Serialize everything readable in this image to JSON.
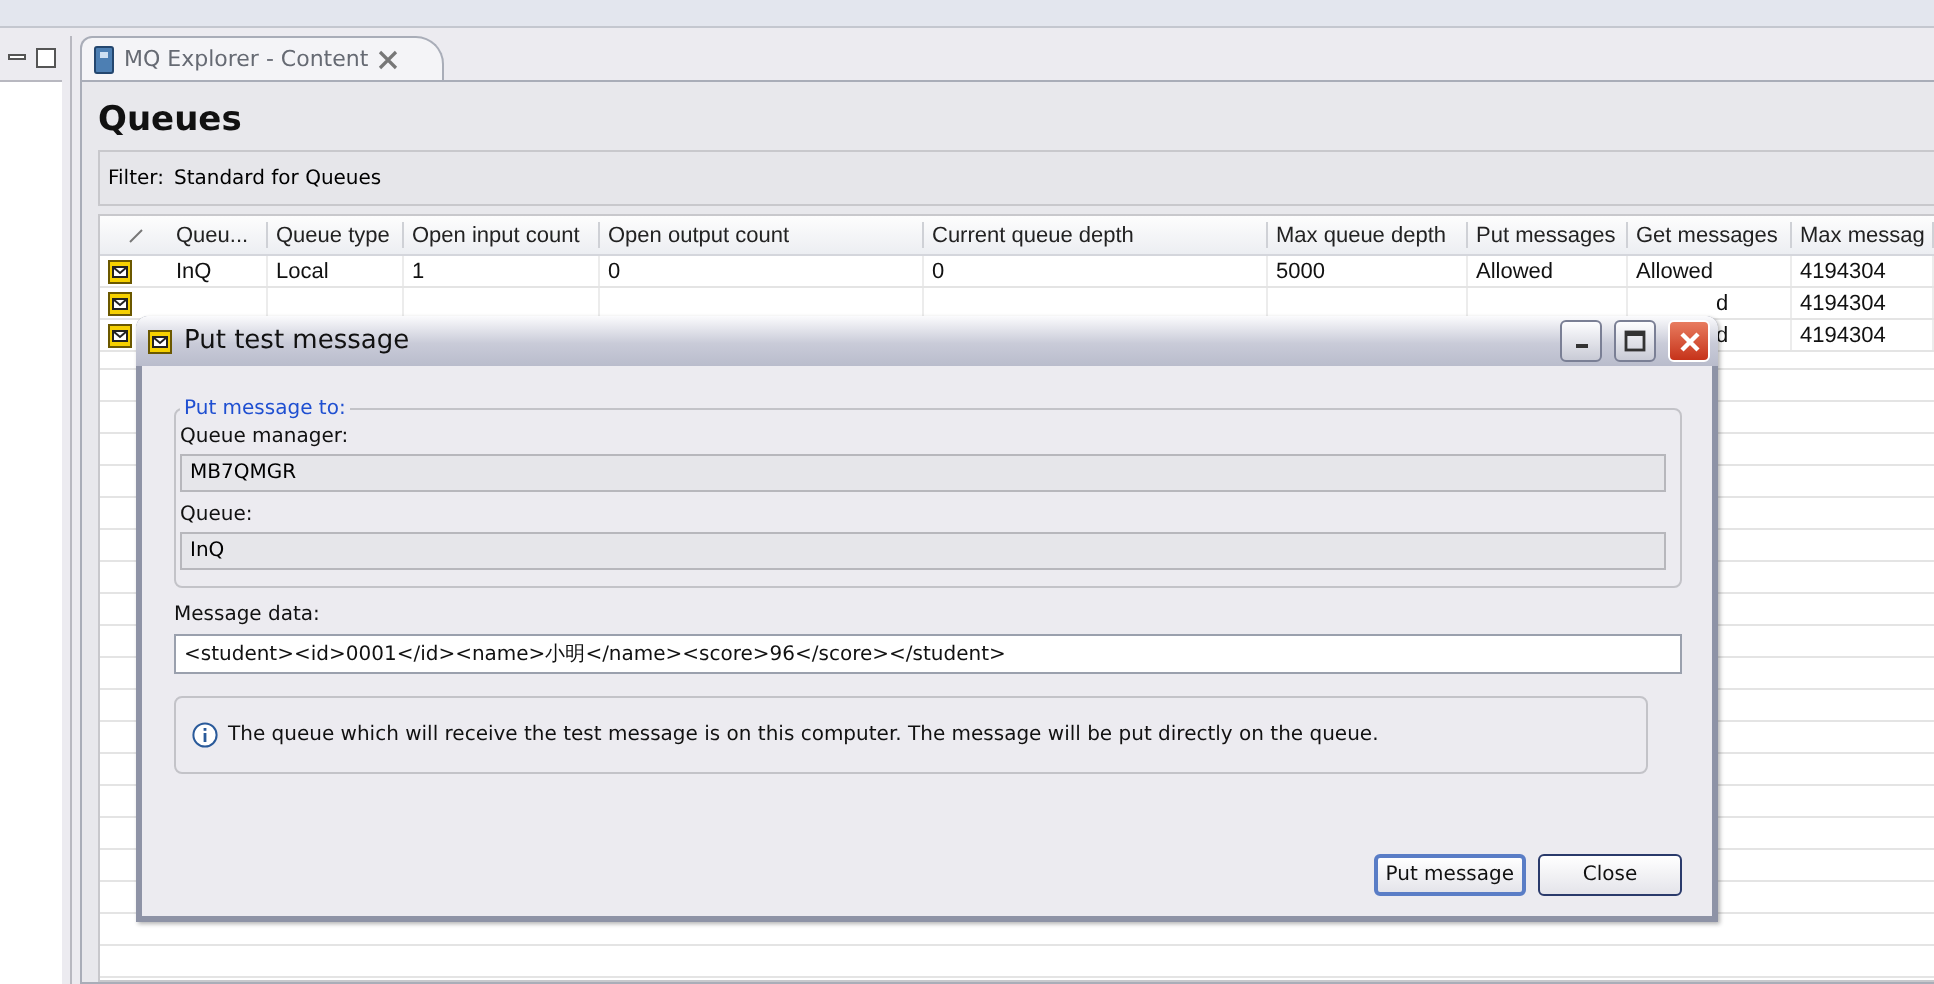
{
  "editor_tab": {
    "title": "MQ Explorer - Content",
    "selected": true
  },
  "heading": "Queues",
  "filter": {
    "label": "Filter:",
    "value": "Standard for Queues"
  },
  "table": {
    "columns": [
      "Queu...",
      "Queue type",
      "Open input count",
      "Open output count",
      "Current queue depth",
      "Max queue depth",
      "Put messages",
      "Get messages",
      "Max messag"
    ],
    "rows": [
      {
        "cells": [
          "InQ",
          "Local",
          "1",
          "0",
          "0",
          "5000",
          "Allowed",
          "Allowed",
          "4194304"
        ]
      },
      {
        "cells": [
          null,
          null,
          null,
          null,
          null,
          null,
          null,
          "d",
          "4194304"
        ]
      },
      {
        "cells": [
          null,
          null,
          null,
          null,
          null,
          null,
          null,
          "d",
          "4194304"
        ]
      }
    ]
  },
  "dialog": {
    "title": "Put test message",
    "group_label": "Put message to:",
    "fields": [
      {
        "label": "Queue manager:",
        "value": "MB7QMGR"
      },
      {
        "label": "Queue:",
        "value": "InQ"
      }
    ],
    "message_label": "Message data:",
    "message_value": "<student><id>0001</id><name>小明</name><score>96</score></student>",
    "info": "The queue which will receive the test message is on this computer. The message will be put directly on the queue.",
    "buttons": [
      {
        "label": "Put message",
        "default": true
      },
      {
        "label": "Close",
        "default": false
      }
    ]
  }
}
